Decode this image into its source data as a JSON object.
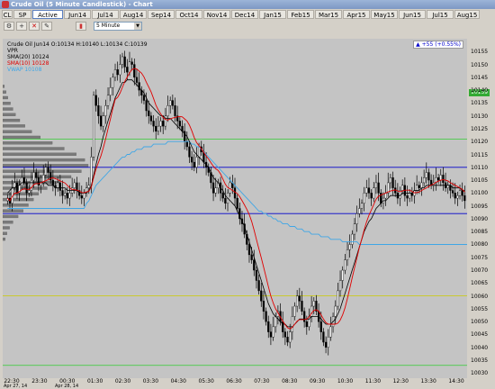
{
  "window": {
    "title": "Crude Oil (5 Minute Candlestick) - Chart"
  },
  "toolbar": {
    "tabs": [
      {
        "label": "CL",
        "active": false
      },
      {
        "label": "SP",
        "active": false
      },
      {
        "label": "Active",
        "active": true
      },
      {
        "label": "Jun14",
        "active": false
      },
      {
        "label": "Jul14",
        "active": false
      },
      {
        "label": "Aug14",
        "active": false
      },
      {
        "label": "Sep14",
        "active": false
      },
      {
        "label": "Oct14",
        "active": false
      },
      {
        "label": "Nov14",
        "active": false
      },
      {
        "label": "Dec14",
        "active": false
      },
      {
        "label": "Jan15",
        "active": false
      },
      {
        "label": "Feb15",
        "active": false
      },
      {
        "label": "Mar15",
        "active": false
      },
      {
        "label": "Apr15",
        "active": false
      },
      {
        "label": "May15",
        "active": false
      },
      {
        "label": "Jun15",
        "active": false
      },
      {
        "label": "Jul15",
        "active": false
      },
      {
        "label": "Aug15",
        "active": false
      }
    ],
    "interval": "5 Minute"
  },
  "chart_header": {
    "quote": "Crude Oil Jun14 O:10134 H:10140 L:10134 C:10139",
    "change": "+55 (+0.55%)",
    "legend": [
      {
        "label": "VPR",
        "color": "#000000"
      },
      {
        "label": "SMA(20)  10124",
        "color": "#000000"
      },
      {
        "label": "SMA(10)  10128",
        "color": "#e00000"
      },
      {
        "label": "VWAP  10108",
        "color": "#3fa6e6"
      }
    ]
  },
  "price_axis": {
    "labels": [
      "10155",
      "10150",
      "10145",
      "10140",
      "10135",
      "10130",
      "10125",
      "10120",
      "10115",
      "10110",
      "10105",
      "10100",
      "10095",
      "10090",
      "10085",
      "10080",
      "10075",
      "10070",
      "10065",
      "10060",
      "10055",
      "10050",
      "10045",
      "10040",
      "10035",
      "10030"
    ],
    "last_price": "10139"
  },
  "time_axis": {
    "labels": [
      "22:30",
      "23:30",
      "00:30",
      "01:30",
      "02:30",
      "03:30",
      "04:30",
      "05:30",
      "06:30",
      "07:30",
      "08:30",
      "09:30",
      "10:30",
      "11:30",
      "12:30",
      "13:30",
      "14:30"
    ],
    "dates": [
      "Apr 27, 14",
      "Apr 28, 14"
    ]
  },
  "chart_data": {
    "type": "candlestick",
    "ylim": [
      10028,
      10160
    ],
    "horizontal_lines": [
      {
        "value": 10121,
        "color": "#33cc33"
      },
      {
        "value": 10110,
        "color": "#0000cc"
      },
      {
        "value": 10092,
        "color": "#0000cc"
      },
      {
        "value": 10060,
        "color": "#cccc00"
      },
      {
        "value": 10033,
        "color": "#33cc33"
      }
    ],
    "closes": [
      10098,
      10096,
      10102,
      10104,
      10100,
      10103,
      10106,
      10104,
      10100,
      10101,
      10105,
      10108,
      10106,
      10103,
      10104,
      10107,
      10110,
      10108,
      10105,
      10103,
      10102,
      10104,
      10101,
      10099,
      10100,
      10098,
      10100,
      10102,
      10104,
      10101,
      10099,
      10098,
      10100,
      10102,
      10103,
      10114,
      10138,
      10134,
      10130,
      10126,
      10130,
      10134,
      10138,
      10141,
      10145,
      10148,
      10146,
      10150,
      10153,
      10149,
      10147,
      10151,
      10150,
      10145,
      10143,
      10140,
      10138,
      10136,
      10132,
      10130,
      10128,
      10126,
      10124,
      10126,
      10128,
      10126,
      10130,
      10134,
      10136,
      10134,
      10130,
      10128,
      10126,
      10124,
      10120,
      10118,
      10114,
      10112,
      10110,
      10114,
      10118,
      10116,
      10112,
      10110,
      10108,
      10104,
      10100,
      10102,
      10104,
      10100,
      10098,
      10096,
      10100,
      10104,
      10102,
      10098,
      10094,
      10090,
      10088,
      10084,
      10080,
      10076,
      10074,
      10070,
      10066,
      10062,
      10058,
      10054,
      10050,
      10046,
      10044,
      10048,
      10052,
      10054,
      10050,
      10046,
      10044,
      10042,
      10046,
      10052,
      10056,
      10060,
      10058,
      10054,
      10050,
      10048,
      10052,
      10056,
      10058,
      10054,
      10050,
      10046,
      10042,
      10040,
      10044,
      10048,
      10052,
      10056,
      10062,
      10066,
      10070,
      10074,
      10078,
      10080,
      10084,
      10088,
      10092,
      10094,
      10096,
      10100,
      10102,
      10100,
      10098,
      10102,
      10104,
      10100,
      10096,
      10098,
      10100,
      10104,
      10106,
      10102,
      10100,
      10098,
      10101,
      10103,
      10099,
      10098,
      10100,
      10099,
      10101,
      10103,
      10102,
      10104,
      10106,
      10108,
      10105,
      10103,
      10104,
      10106,
      10105,
      10107,
      10104,
      10102,
      10103,
      10101,
      10100,
      10098,
      10099,
      10101,
      10099,
      10097
    ],
    "sma20": [
      10100,
      10101,
      10102,
      10102,
      10103,
      10103,
      10104,
      10104,
      10104,
      10104,
      10104,
      10104,
      10104,
      10104,
      10104,
      10104,
      10104,
      10103,
      10103,
      10103,
      10102,
      10102,
      10102,
      10102,
      10102,
      10101,
      10101,
      10101,
      10101,
      10101,
      10100,
      10100,
      10100,
      10100,
      10101,
      10103,
      10107,
      10111,
      10115,
      10118,
      10122,
      10125,
      10128,
      10131,
      10134,
      10137,
      10139,
      10141,
      10143,
      10143,
      10144,
      10144,
      10144,
      10143,
      10142,
      10141,
      10140,
      10139,
      10137,
      10135,
      10134,
      10133,
      10132,
      10131,
      10130,
      10130,
      10129,
      10129,
      10129,
      10128,
      10127,
      10126,
      10125,
      10124,
      10123,
      10122,
      10120,
      10118,
      10116,
      10115,
      10114,
      10113,
      10112,
      10111,
      10110,
      10108,
      10106,
      10105,
      10104,
      10102,
      10101,
      10099,
      10098,
      10097,
      10096,
      10095,
      10093,
      10091,
      10089,
      10087,
      10084,
      10081,
      10078,
      10075,
      10072,
      10069,
      10066,
      10063,
      10060,
      10057,
      10055,
      10053,
      10052,
      10051,
      10050,
      10049,
      10049,
      10048,
      10048,
      10048,
      10049,
      10050,
      10051,
      10051,
      10051,
      10051,
      10051,
      10052,
      10052,
      10052,
      10052,
      10051,
      10050,
      10049,
      10049,
      10049,
      10050,
      10051,
      10053,
      10055,
      10058,
      10061,
      10064,
      10067,
      10070,
      10073,
      10076,
      10079,
      10082,
      10085,
      10087,
      10089,
      10090,
      10092,
      10094,
      10095,
      10096,
      10097,
      10097,
      10098,
      10099,
      10099,
      10099,
      10099,
      10099,
      10100,
      10100,
      10100,
      10100,
      10100,
      10101,
      10101,
      10101,
      10102,
      10102,
      10103,
      10103,
      10103,
      10103,
      10103,
      10103,
      10103,
      10103,
      10103,
      10103,
      10103,
      10102,
      10102,
      10102,
      10102,
      10101,
      10101
    ],
    "vwap_level": [
      10094,
      10094,
      10094,
      10094,
      10094,
      10094,
      10094,
      10094,
      10094,
      10094,
      10094,
      10094,
      10094,
      10094,
      10094,
      10094,
      10094,
      10094,
      10094,
      10094,
      10094,
      10094,
      10094,
      10094,
      10094,
      10094,
      10094,
      10094,
      10094,
      10094,
      10094,
      10094,
      10094,
      10096,
      10097,
      10099,
      10101,
      10103,
      10104,
      10105,
      10106,
      10107,
      10108,
      10109,
      10110,
      10111,
      10112,
      10113,
      10114,
      10114,
      10115,
      10115,
      10116,
      10116,
      10117,
      10117,
      10117,
      10118,
      10118,
      10118,
      10118,
      10119,
      10119,
      10119,
      10119,
      10119,
      10119,
      10120,
      10120,
      10120,
      10120,
      10120,
      10120,
      10120,
      10120,
      10120,
      10120,
      10119,
      10119,
      10118,
      10118,
      10117,
      10116,
      10115,
      10114,
      10113,
      10112,
      10111,
      10110,
      10109,
      10108,
      10107,
      10106,
      10105,
      10104,
      10103,
      10102,
      10101,
      10100,
      10099,
      10098,
      10097,
      10096,
      10095,
      10094,
      10093,
      10093,
      10092,
      10092,
      10091,
      10091,
      10090,
      10090,
      10089,
      10089,
      10088,
      10088,
      10088,
      10087,
      10087,
      10087,
      10086,
      10086,
      10086,
      10085,
      10085,
      10085,
      10084,
      10084,
      10084,
      10084,
      10083,
      10083,
      10083,
      10083,
      10082,
      10082,
      10082,
      10082,
      10082,
      10081,
      10081,
      10081,
      10081,
      10081,
      10081,
      10081,
      10080,
      10080,
      10080,
      10080,
      10080,
      10080,
      10080,
      10080,
      10080,
      10080,
      10080,
      10080,
      10080,
      10080,
      10080,
      10080,
      10080,
      10080,
      10080,
      10080,
      10080,
      10080,
      10080,
      10080,
      10080,
      10080,
      10080,
      10080,
      10080,
      10080,
      10080,
      10080,
      10080,
      10080,
      10080,
      10080,
      10080,
      10080,
      10080,
      10080,
      10080,
      10080,
      10080,
      10080,
      10080,
      10080,
      10080,
      10080,
      10080,
      10080
    ]
  },
  "colors": {
    "plot_bg": "#c4c4c4",
    "up": "#ffffff",
    "down": "#000000",
    "sma10": "#e00000",
    "sma20": "#000000",
    "vwap": "#3fa6e6",
    "vpr": "#7a7a7a"
  }
}
